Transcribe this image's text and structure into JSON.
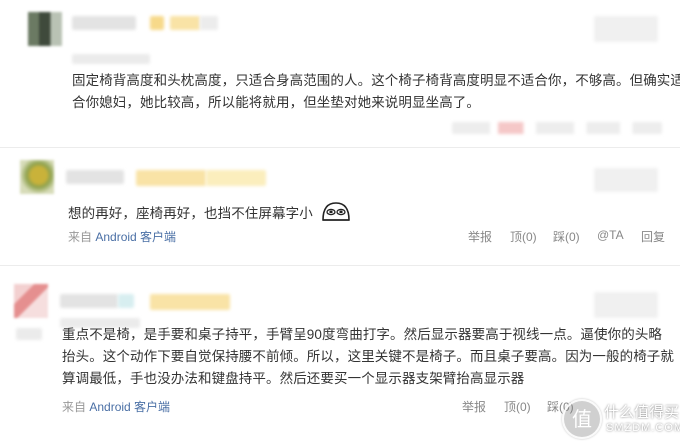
{
  "comments": [
    {
      "text_lines": [
        "固定椅背高度和头枕高度，只适合身高范围的人。这个椅子椅背高度明显不适合你，不够高。但确实适",
        "合你媳妇，她比较高，所以能将就用，但坐垫对她来说明显坐高了。"
      ]
    },
    {
      "text_lines": [
        "想的再好，座椅再好，也挡不住屏幕字小"
      ],
      "source_prefix": "来自",
      "source_client": "Android 客户端",
      "actions": [
        "举报",
        "顶(0)",
        "踩(0)",
        "@TA",
        "回复"
      ]
    },
    {
      "text_lines": [
        "重点不是椅，是手要和桌子持平，手臂呈90度弯曲打字。然后显示器要高于视线一点。逼使你的头略",
        "抬头。这个动作下要自觉保持腰不前倾。所以，这里关键不是椅子。而且桌子要高。因为一般的椅子就",
        "算调最低，手也没办法和键盘持平。然后还要买一个显示器支架臂抬高显示器"
      ],
      "source_prefix": "来自",
      "source_client": "Android 客户端",
      "actions": [
        "举报",
        "顶(0)",
        "踩(0)"
      ]
    }
  ],
  "watermark": {
    "glyph": "值",
    "text": "什么值得买",
    "sub": "SMZDM.COM"
  },
  "colors": {
    "link": "#4a6fa5",
    "meta": "#999999",
    "separator": "#ececec",
    "blur_gray": "#e6e6e6",
    "blur_yellow": "#f7d98a",
    "blur_pink": "#f5c2c2"
  }
}
